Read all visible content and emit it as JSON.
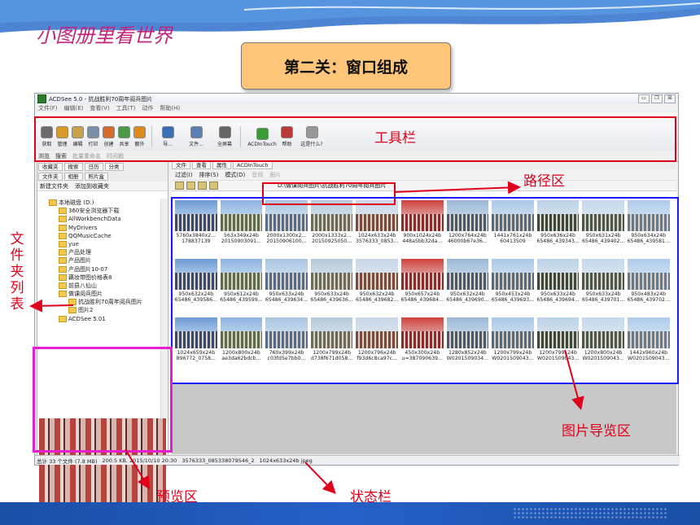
{
  "slide": {
    "title": "小图册里看世界",
    "heading": "第二关：窗口组成"
  },
  "window": {
    "title": "ACDSee 5.0 - 抗战胜利70周年阅兵图片",
    "controls": [
      "▭",
      "❐",
      "☒"
    ],
    "menu": [
      "文件(F)",
      "编辑(E)",
      "查看(V)",
      "工具(T)",
      "动作",
      "帮助(H)"
    ]
  },
  "toolbar": {
    "buttons": [
      {
        "label": "获取",
        "icon": "camera-icon",
        "color": "#6b6b6b"
      },
      {
        "label": "管理",
        "icon": "folder-manage-icon",
        "color": "#d99a2b"
      },
      {
        "label": "编辑",
        "icon": "edit-icon",
        "color": "#c9a24a"
      },
      {
        "label": "打印",
        "icon": "print-icon",
        "color": "#7b8fa6"
      },
      {
        "label": "创建",
        "icon": "create-icon",
        "color": "#d86a2a"
      },
      {
        "label": "共享",
        "icon": "share-icon",
        "color": "#4a9a4a"
      },
      {
        "label": "额外",
        "icon": "extra-icon",
        "color": "#e08a1a"
      },
      {
        "label": "导...",
        "icon": "navigate-icon",
        "color": "#3b6fb5"
      },
      {
        "label": "文件...",
        "icon": "file-icon",
        "color": "#5a7fb5"
      },
      {
        "label": "全屏幕",
        "icon": "fullscreen-icon",
        "color": "#666666"
      },
      {
        "label": "ACDInTouch",
        "icon": "acdintouch-icon",
        "color": "#3a9a3a"
      },
      {
        "label": "帮助",
        "icon": "help-book-icon",
        "color": "#b83a3a"
      },
      {
        "label": "这是什么?",
        "icon": "whats-this-icon",
        "color": "#999999"
      }
    ],
    "secondary": [
      {
        "label": "浏览",
        "active": true
      },
      {
        "label": "搜索",
        "active": true
      },
      {
        "label": "批量重命名",
        "active": false
      },
      {
        "label": "时间戳",
        "active": false
      }
    ]
  },
  "left_panel": {
    "tabs": [
      "收藏夹",
      "搜索",
      "日历",
      "分类",
      "文件夹",
      "相册",
      "照片盒"
    ],
    "actions": [
      "新建文件夹",
      "添加到收藏夹"
    ],
    "tree": [
      {
        "label": "本地磁盘 (D:)",
        "depth": 0
      },
      {
        "label": "360安全浏览器下载",
        "depth": 1
      },
      {
        "label": "AllWorkbenchData",
        "depth": 1
      },
      {
        "label": "MyDrivers",
        "depth": 1
      },
      {
        "label": "QQMusicCache",
        "depth": 1
      },
      {
        "label": "yue",
        "depth": 1
      },
      {
        "label": "产品处理",
        "depth": 1
      },
      {
        "label": "产品图片",
        "depth": 1
      },
      {
        "label": "产品图片10-07",
        "depth": 1
      },
      {
        "label": "藕妆带图价格表8",
        "depth": 1
      },
      {
        "label": "前县八仙山",
        "depth": 1
      },
      {
        "label": "做课阅兵图片",
        "depth": 1
      },
      {
        "label": "抗战胜利70周年阅兵图片",
        "depth": 2
      },
      {
        "label": "图片2",
        "depth": 2
      },
      {
        "label": "ACDSee 5.01",
        "depth": 1
      }
    ]
  },
  "right_panel": {
    "tabs": [
      "文件",
      "查看",
      "属性",
      "ACDInTouch"
    ],
    "tools": [
      "过滤(I)",
      "排序(S)",
      "模式(D)",
      "音频",
      "圈片"
    ],
    "path": "D:\\做课阅兵图片\\抗战胜利70周年阅兵图片",
    "thumbnails": [
      {
        "res": "5760x3840x2...",
        "name": "178837139"
      },
      {
        "res": "563x349x24b",
        "name": "20150903091..."
      },
      {
        "res": "2000x1300x2...",
        "name": "20150906100..."
      },
      {
        "res": "2000x1333x2...",
        "name": "20150925050..."
      },
      {
        "res": "1024x633x24b",
        "name": "3576333_0853..."
      },
      {
        "res": "900x1024x24b",
        "name": "448a5bb32da..."
      },
      {
        "res": "1200x764x24b",
        "name": "46000b67e36..."
      },
      {
        "res": "1441x761x24b",
        "name": "60413509"
      },
      {
        "res": "950x636x24b",
        "name": "65486_439343..."
      },
      {
        "res": "950x631x24b",
        "name": "65486_439402..."
      },
      {
        "res": "950x634x24b",
        "name": "65486_439581..."
      },
      {
        "res": "950x632x24b",
        "name": "65486_439586..."
      },
      {
        "res": "950x612x24b",
        "name": "65486_439599..."
      },
      {
        "res": "950x633x24b",
        "name": "65486_439634..."
      },
      {
        "res": "950x633x24b",
        "name": "65486_439636..."
      },
      {
        "res": "950x632x24b",
        "name": "65486_439682..."
      },
      {
        "res": "950x657x24b",
        "name": "65486_439684..."
      },
      {
        "res": "950x632x24b",
        "name": "65486_439690..."
      },
      {
        "res": "950x453x24b",
        "name": "65486_439693..."
      },
      {
        "res": "950x633x24b",
        "name": "65486_439694..."
      },
      {
        "res": "950x633x24b",
        "name": "65486_439701..."
      },
      {
        "res": "950x483x24b",
        "name": "65486_439702..."
      },
      {
        "res": "1024x659x24b",
        "name": "896772_0758..."
      },
      {
        "res": "1200x800x24b",
        "name": "ae3da62bdcb..."
      },
      {
        "res": "760x399x24b",
        "name": "c03fd5e7bb0..."
      },
      {
        "res": "1200x799x24b",
        "name": "d738f671d058..."
      },
      {
        "res": "1200x796x24b",
        "name": "f93d6c8ca97c..."
      },
      {
        "res": "450x300x24b",
        "name": "u=387090639..."
      },
      {
        "res": "1280x852x24b",
        "name": "W0201509034..."
      },
      {
        "res": "1200x799x24b",
        "name": "W0201509043..."
      },
      {
        "res": "1200x799x24b",
        "name": "W0201509043..."
      },
      {
        "res": "1200x800x24b",
        "name": "W0201509043..."
      },
      {
        "res": "1442x960x24b",
        "name": "W0201509043..."
      }
    ]
  },
  "status_bar": {
    "total": "总计 33 个文件 (7.8 MB)",
    "size_date": "200.5 KB, 2015/10/10 20:30",
    "filename": "3576333_085338079546_2",
    "info": "1024x633x24b jpeg"
  },
  "annotations": {
    "toolbar": "工具栏",
    "path_area": "路径区",
    "folder_list": "文件夹列表",
    "image_browser": "图片导览区",
    "preview": "预览区",
    "status_bar": "状态栏",
    "colors": {
      "red": "#e0001b",
      "blue": "#1a1aff",
      "magenta": "#e81fd0"
    }
  }
}
